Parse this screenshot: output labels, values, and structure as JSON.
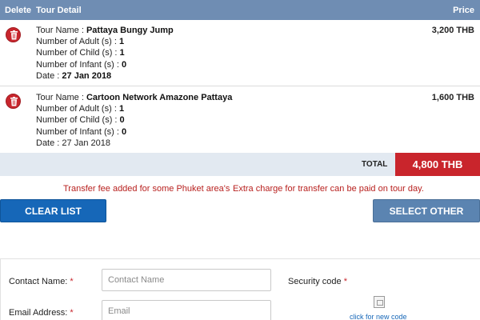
{
  "header": {
    "delete_label": "Delete",
    "detail_label": "Tour Detail",
    "price_label": "Price"
  },
  "tours": [
    {
      "name_label": "Tour Name : ",
      "name": "Pattaya Bungy Jump",
      "adult_label": "Number of Adult (s) : ",
      "adult": "1",
      "child_label": "Number of Child (s) : ",
      "child": "1",
      "infant_label": "Number of Infant (s) : ",
      "infant": "0",
      "date_label": "Date : ",
      "date": "27 Jan 2018",
      "price": "3,200 THB"
    },
    {
      "name_label": "Tour Name : ",
      "name": "Cartoon Network Amazone Pattaya",
      "adult_label": "Number of Adult (s) : ",
      "adult": "1",
      "child_label": "Number of Child (s) : ",
      "child": "0",
      "infant_label": "Number of Infant (s) : ",
      "infant": "0",
      "date_label": "Date : ",
      "date": "27 Jan 2018",
      "price": "1,600 THB"
    }
  ],
  "total": {
    "label": "TOTAL",
    "amount": "4,800 THB"
  },
  "notes": {
    "transfer_fee": "Transfer fee added for some Phuket area's",
    "extra_charge": "Extra charge for transfer can be paid on tour day."
  },
  "buttons": {
    "clear_list": "CLEAR LIST",
    "select_other_tours": "SELECT OTHER TOURS"
  },
  "form": {
    "contact_name_label": "Contact Name: ",
    "contact_name_placeholder": "Contact Name",
    "email_label": "Email Address: ",
    "email_placeholder": "Email",
    "security_code_label": "Security code ",
    "required_mark": "*",
    "new_code_link": "click for new code"
  },
  "colors": {
    "header_bg": "#6f8db3",
    "total_bg": "#c9252c",
    "clear_btn": "#1667b8",
    "select_btn": "#5b84b1",
    "note_text": "#b8211f"
  },
  "icons": {
    "delete": "trash-icon",
    "captcha": "broken-image-icon"
  }
}
